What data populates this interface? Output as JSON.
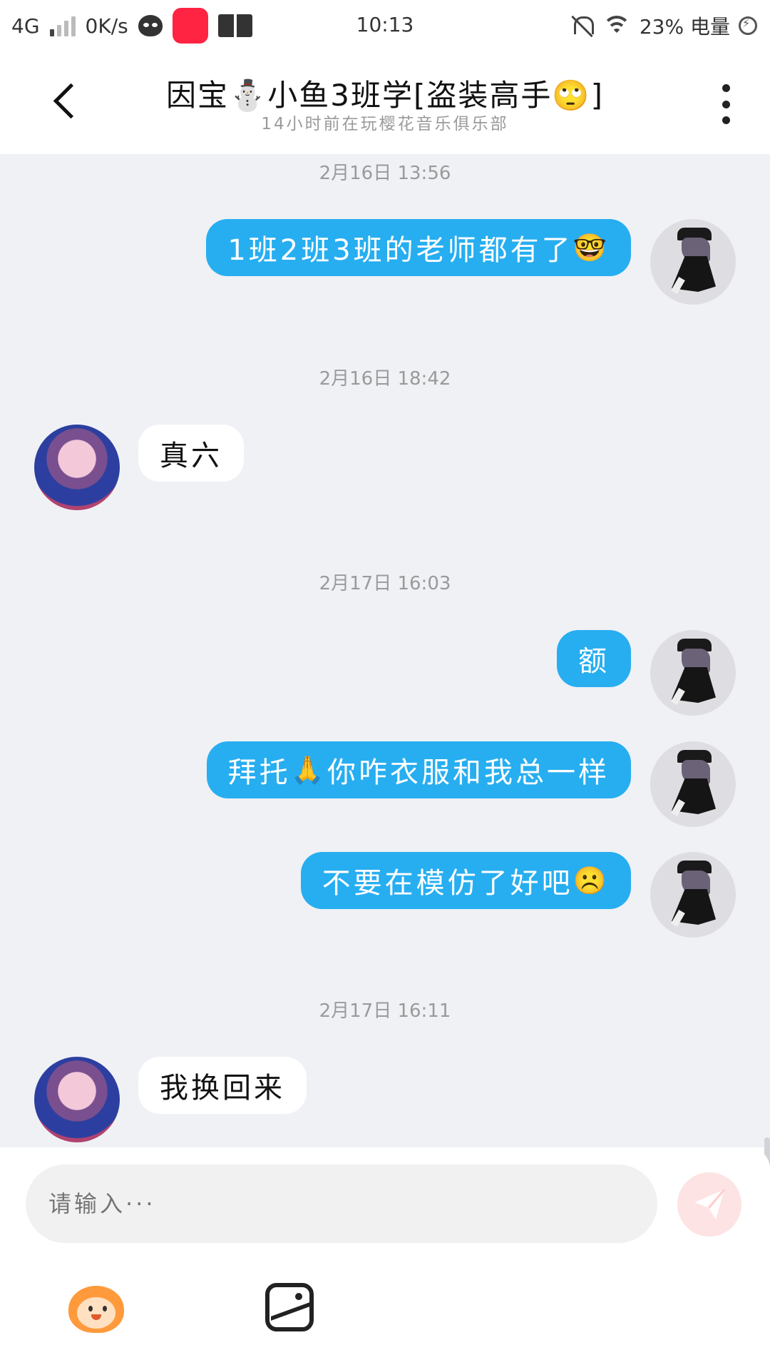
{
  "status_bar": {
    "network": "4G",
    "speed": "0K/s",
    "time": "10:13",
    "battery": "23% 电量"
  },
  "header": {
    "title": "因宝⛄小鱼3班学[盗装高手🙄]",
    "subtitle": "14小时前在玩樱花音乐俱乐部"
  },
  "messages": [
    {
      "timestamp": "2月16日 13:56",
      "sender": "me",
      "text": "1班2班3班的老师都有了",
      "emoji": "🤓"
    },
    {
      "timestamp": "2月16日 18:42",
      "sender": "them",
      "text": "真六"
    },
    {
      "timestamp": "2月17日 16:03",
      "sender": "me",
      "text": "额"
    },
    {
      "sender": "me",
      "text": "拜托",
      "emoji": "🙏",
      "text_after": "你咋衣服和我总一样"
    },
    {
      "sender": "me",
      "text": "不要在模仿了好吧",
      "emoji": "☹️"
    },
    {
      "timestamp": "2月17日 16:11",
      "sender": "them",
      "text": "我换回来"
    }
  ],
  "input": {
    "placeholder": "请输入···"
  },
  "colors": {
    "my_bubble": "#27aef0",
    "their_bubble": "#ffffff",
    "chat_bg": "#eff1f5",
    "send_button": "#fde3e3"
  },
  "icons": {
    "back": "chevron-left-icon",
    "more": "more-vertical-icon",
    "send": "paper-plane-icon",
    "emoji": "monkey-face-icon",
    "image": "image-icon"
  }
}
